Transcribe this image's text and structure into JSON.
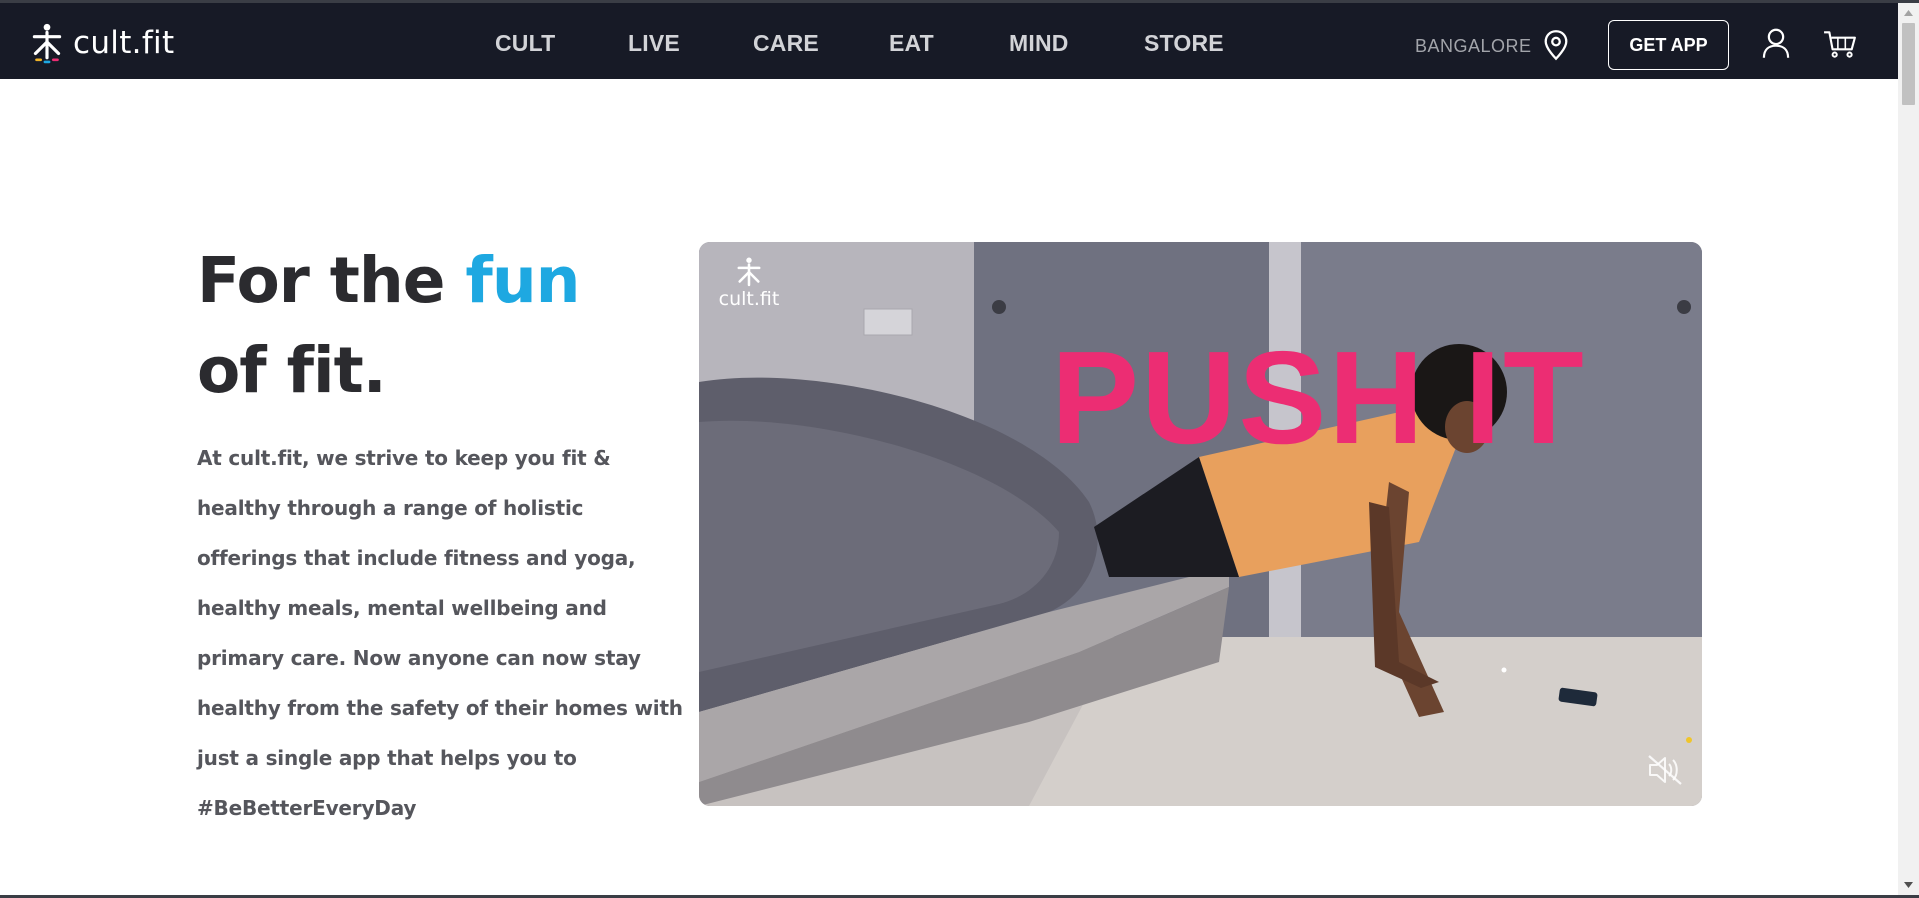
{
  "brand": {
    "name": "cult.fit"
  },
  "nav": {
    "items": [
      {
        "label": "CULT"
      },
      {
        "label": "LIVE"
      },
      {
        "label": "CARE"
      },
      {
        "label": "EAT"
      },
      {
        "label": "MIND"
      },
      {
        "label": "STORE"
      }
    ],
    "city": "BANGALORE",
    "get_app": "GET APP",
    "icons": {
      "location": "location-pin-icon",
      "user": "user-icon",
      "cart": "cart-icon"
    }
  },
  "hero": {
    "title_part1": "For the ",
    "title_accent": "fun",
    "title_part2": "of fit.",
    "description": "At cult.fit, we strive to keep you fit & healthy through a range of holistic offerings that include fitness and yoga, healthy meals, mental wellbeing and primary care. Now anyone can now stay healthy from the safety of their homes with just a single app that helps you to #BeBetterEveryDay"
  },
  "video": {
    "logo_text": "cult.fit",
    "overlay_text": "PUSH IT",
    "mute_icon": "mute-icon"
  },
  "colors": {
    "nav_bg": "#171a26",
    "accent": "#1ea8e1",
    "headline": "#2b2b2f",
    "video_text": "#ec2d73"
  }
}
